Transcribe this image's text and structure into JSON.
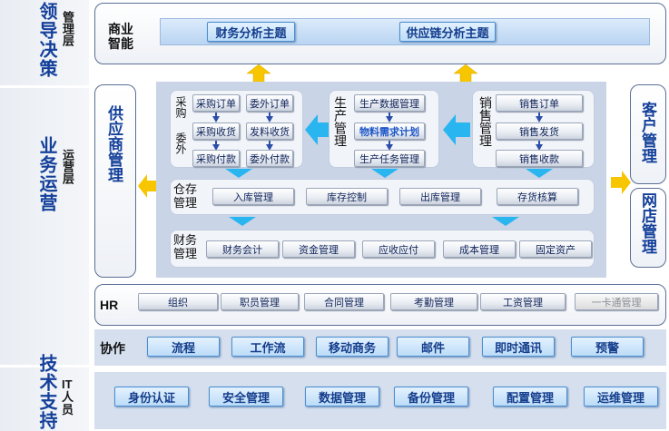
{
  "left_column": {
    "decision": {
      "title": "领导决策",
      "level": "管理层"
    },
    "operation": {
      "title": "业务运营",
      "level": "运营层"
    },
    "tech": {
      "title": "技术支持",
      "level": "IT人员"
    }
  },
  "bi": {
    "label": "商业智能",
    "items": [
      "财务分析主题",
      "供应链分析主题"
    ]
  },
  "supplier": {
    "title": "供应商管理"
  },
  "purchase": {
    "group_labels": [
      "采购",
      "委外"
    ],
    "purchase_items": [
      "采购订单",
      "采购收货",
      "采购付款"
    ],
    "outsource_items": [
      "委外订单",
      "发料收货",
      "委外付款"
    ]
  },
  "production": {
    "title": "生产管理",
    "items": [
      "生产数据管理",
      "物料需求计划",
      "生产任务管理"
    ]
  },
  "sales": {
    "title": "销售管理",
    "items": [
      "销售订单",
      "销售发货",
      "销售收款"
    ]
  },
  "warehouse": {
    "title": "仓存管理",
    "items": [
      "入库管理",
      "库存控制",
      "出库管理",
      "存货核算"
    ]
  },
  "finance": {
    "title": "财务管理",
    "items": [
      "财务会计",
      "资金管理",
      "应收应付",
      "成本管理",
      "固定资产"
    ]
  },
  "customer": {
    "title": "客户管理"
  },
  "online_store": {
    "title": "网店管理"
  },
  "hr": {
    "label": "HR",
    "items": [
      "组织",
      "职员管理",
      "合同管理",
      "考勤管理",
      "工资管理",
      "一卡通管理"
    ]
  },
  "collab": {
    "label": "协作",
    "items": [
      "流程",
      "工作流",
      "移动商务",
      "邮件",
      "即时通讯",
      "预警"
    ]
  },
  "it": {
    "items": [
      "身份认证",
      "安全管理",
      "数据管理",
      "备份管理",
      "配置管理",
      "运维管理"
    ]
  },
  "colors": {
    "accent": "#1a5fc8",
    "arrow_yellow": "#f7c600",
    "arrow_blue": "#29b6f0"
  }
}
